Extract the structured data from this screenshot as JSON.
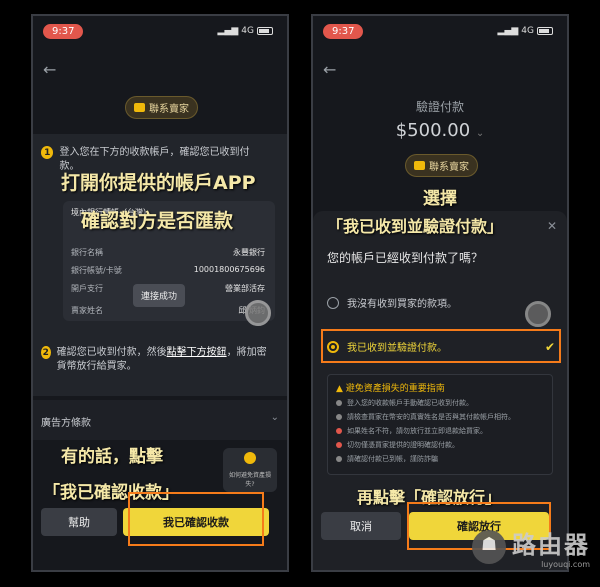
{
  "left": {
    "status": {
      "time": "9:37",
      "net": "4G"
    },
    "contact_seller": "聯系賣家",
    "step1": {
      "num": "1",
      "text": "登入您在下方的收款帳戶，確認您已收到付款。"
    },
    "bank": {
      "title": "境內銀行轉帳（台灣）",
      "rows": [
        {
          "label": "銀行名稱",
          "value": "永豐銀行"
        },
        {
          "label": "銀行帳號/卡號",
          "value": "10001800675696"
        },
        {
          "label": "開戶支行",
          "value": "營業部活存"
        },
        {
          "label": "賣家姓名",
          "value": "邱 炳鈞"
        }
      ],
      "toast": "連接成功"
    },
    "overlay1": "打開你提供的帳戶APP",
    "overlay2": "確認對方是否匯款",
    "step2": {
      "num": "2",
      "text_a": "確認您已收到付款，然後",
      "text_link": "點擊下方按鈕",
      "text_b": "，將加密貨幣放行給買家。"
    },
    "advertiser_terms": "廣告方條款",
    "overlay3": "有的話，點擊",
    "overlay4": "「我已確認收款」",
    "help_btn": "幫助",
    "confirm_btn": "我已確認收款",
    "float_hint": "如何避免資產損失?"
  },
  "right": {
    "status": {
      "time": "9:37",
      "net": "4G"
    },
    "verify_title": "驗證付款",
    "amount": "$500.00",
    "contact_seller": "聯系賣家",
    "overlay_select": "選擇",
    "overlay_option": "「我已收到並驗證付款」",
    "question": "您的帳戶已經收到付款了嗎？",
    "option_no": "我沒有收到買家的款項。",
    "option_yes": "我已收到並驗證付款。",
    "guide": {
      "head": "避免資產損失的重要指南",
      "items": [
        "登入您的收款帳戶手動確認已收到付款。",
        "請檢查買家在幣安的真實姓名是否與其付款帳戶相符。",
        "如果姓名不符，請勿放行並立即退款給買家。",
        "切勿僅憑買家提供的證明確認付款。",
        "請確認付款已到帳，謹防詐騙"
      ]
    },
    "overlay_release": "再點擊「確認放行」",
    "cancel_btn": "取消",
    "release_btn": "確認放行"
  },
  "watermark": {
    "text": "路由器",
    "sub": "luyouqi.com"
  },
  "colors": {
    "accent": "#f0b90b",
    "highlight": "#f57b1a",
    "button": "#f0d63a"
  }
}
